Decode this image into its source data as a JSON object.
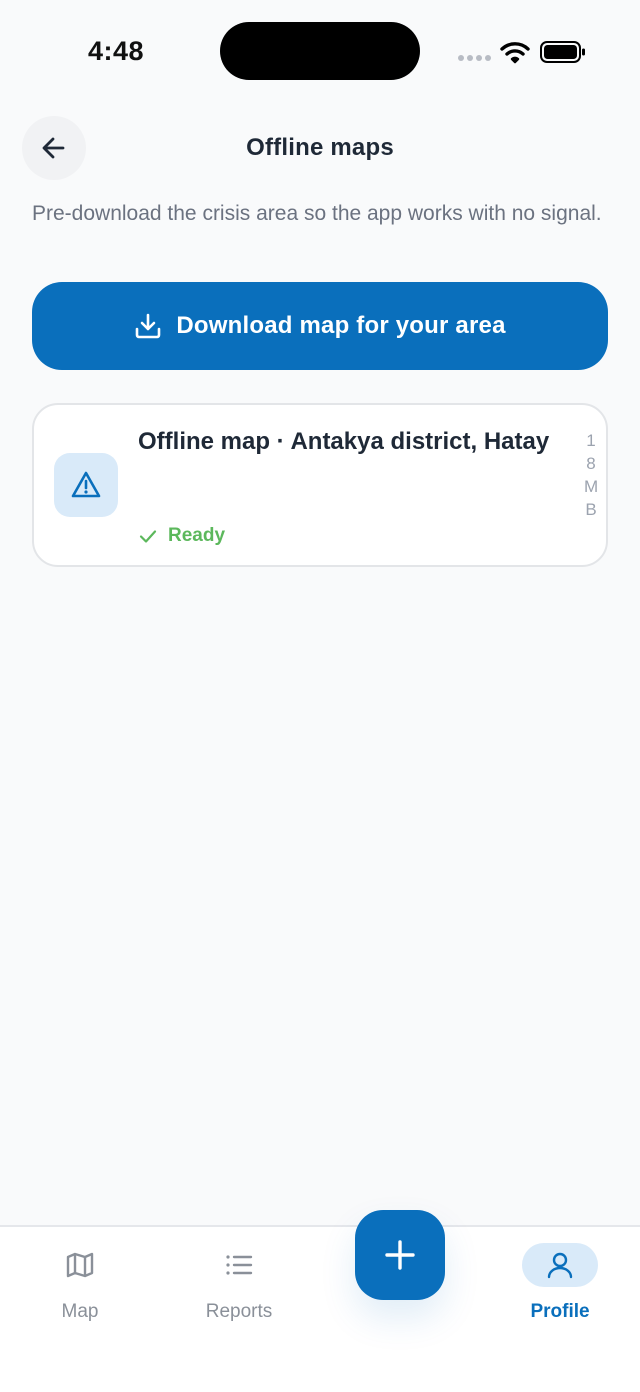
{
  "status_bar": {
    "time": "4:48",
    "icons": [
      "signal-dots-icon",
      "wifi-icon",
      "battery-icon"
    ]
  },
  "header": {
    "title": "Offline maps",
    "back_icon": "arrow-left-icon"
  },
  "description": "Pre-download the crisis area so the app works with no signal.",
  "download_button": {
    "label": "Download map for your area",
    "icon": "download-icon"
  },
  "map_card": {
    "title": "Offline map · Antakya district, Hatay",
    "size": "18MB",
    "status": "Ready",
    "icon": "warning-triangle-icon",
    "status_icon": "check-icon"
  },
  "bottom_nav": {
    "items": [
      {
        "label": "Map",
        "icon": "map-icon",
        "active": false
      },
      {
        "label": "Reports",
        "icon": "list-icon",
        "active": false
      },
      {
        "label": "Profile",
        "icon": "user-icon",
        "active": true
      }
    ],
    "fab_icon": "plus-icon"
  },
  "colors": {
    "primary": "#0a6fbc",
    "background": "#f9fafb",
    "ready": "#5cb85c",
    "muted": "#6b7280"
  }
}
